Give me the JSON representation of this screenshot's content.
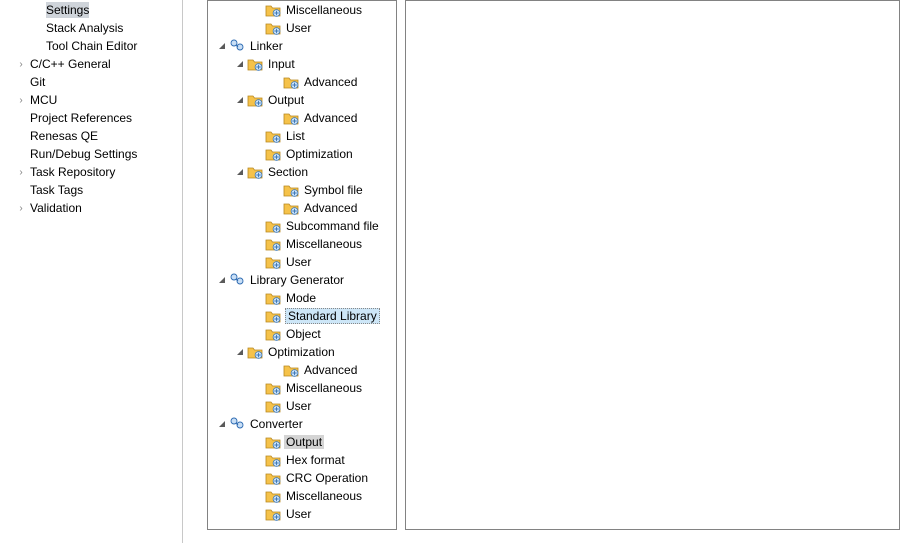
{
  "left": {
    "items": [
      {
        "label": "Settings",
        "indent": 46,
        "selected": true,
        "arrow": false
      },
      {
        "label": "Stack Analysis",
        "indent": 46,
        "arrow": false
      },
      {
        "label": "Tool Chain Editor",
        "indent": 46,
        "arrow": false
      },
      {
        "label": "C/C++ General",
        "indent": 30,
        "arrow": true
      },
      {
        "label": "Git",
        "indent": 30,
        "arrow": false
      },
      {
        "label": "MCU",
        "indent": 30,
        "arrow": true
      },
      {
        "label": "Project References",
        "indent": 30,
        "arrow": false
      },
      {
        "label": "Renesas QE",
        "indent": 30,
        "arrow": false
      },
      {
        "label": "Run/Debug Settings",
        "indent": 30,
        "arrow": false
      },
      {
        "label": "Task Repository",
        "indent": 30,
        "arrow": true
      },
      {
        "label": "Task Tags",
        "indent": 30,
        "arrow": false
      },
      {
        "label": "Validation",
        "indent": 30,
        "arrow": true
      }
    ]
  },
  "tree": [
    {
      "lvl": 3,
      "icon": "folder",
      "label": "Miscellaneous"
    },
    {
      "lvl": 3,
      "icon": "folder",
      "label": "User"
    },
    {
      "lvl": 1,
      "toggle": "open",
      "icon": "tool",
      "label": "Linker"
    },
    {
      "lvl": 2,
      "toggle": "open",
      "icon": "folder",
      "label": "Input"
    },
    {
      "lvl": 4,
      "icon": "folder",
      "label": "Advanced"
    },
    {
      "lvl": 2,
      "toggle": "open",
      "icon": "folder",
      "label": "Output"
    },
    {
      "lvl": 4,
      "icon": "folder",
      "label": "Advanced"
    },
    {
      "lvl": 3,
      "icon": "folder",
      "label": "List"
    },
    {
      "lvl": 3,
      "icon": "folder",
      "label": "Optimization"
    },
    {
      "lvl": 2,
      "toggle": "open",
      "icon": "folder",
      "label": "Section"
    },
    {
      "lvl": 4,
      "icon": "folder",
      "label": "Symbol file"
    },
    {
      "lvl": 4,
      "icon": "folder",
      "label": "Advanced"
    },
    {
      "lvl": 3,
      "icon": "folder",
      "label": "Subcommand file"
    },
    {
      "lvl": 3,
      "icon": "folder",
      "label": "Miscellaneous"
    },
    {
      "lvl": 3,
      "icon": "folder",
      "label": "User"
    },
    {
      "lvl": 1,
      "toggle": "open",
      "icon": "tool",
      "label": "Library Generator"
    },
    {
      "lvl": 3,
      "icon": "folder",
      "label": "Mode"
    },
    {
      "lvl": 3,
      "icon": "folder",
      "label": "Standard Library",
      "sel": "blue"
    },
    {
      "lvl": 3,
      "icon": "folder",
      "label": "Object"
    },
    {
      "lvl": 2,
      "toggle": "open",
      "icon": "folder",
      "label": "Optimization"
    },
    {
      "lvl": 4,
      "icon": "folder",
      "label": "Advanced"
    },
    {
      "lvl": 3,
      "icon": "folder",
      "label": "Miscellaneous"
    },
    {
      "lvl": 3,
      "icon": "folder",
      "label": "User"
    },
    {
      "lvl": 1,
      "toggle": "open",
      "icon": "tool",
      "label": "Converter"
    },
    {
      "lvl": 3,
      "icon": "folder",
      "label": "Output",
      "sel": "gray"
    },
    {
      "lvl": 3,
      "icon": "folder",
      "label": "Hex format"
    },
    {
      "lvl": 3,
      "icon": "folder",
      "label": "CRC Operation"
    },
    {
      "lvl": 3,
      "icon": "folder",
      "label": "Miscellaneous"
    },
    {
      "lvl": 3,
      "icon": "folder",
      "label": "User"
    }
  ]
}
